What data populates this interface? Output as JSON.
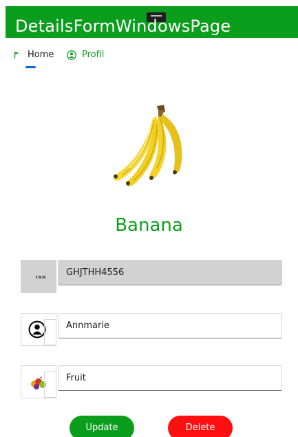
{
  "window": {
    "title": "DetailsFormWindowsPage",
    "accent": "#0b9d1c"
  },
  "nav": {
    "items": [
      {
        "label": "Home",
        "icon": "flag-icon",
        "selected": true
      },
      {
        "label": "Profil",
        "icon": "person-circle-icon",
        "selected": false
      }
    ],
    "selected_indicator_color": "#1565d8"
  },
  "product": {
    "image": "banana-image",
    "name": "Banana"
  },
  "fields": {
    "code": {
      "icon": "barcode-icon",
      "value": "GHJTHH4556",
      "disabled": true
    },
    "name": {
      "icon": "person-icon",
      "value": "Annmarie"
    },
    "category": {
      "icon": "fruit-icon",
      "value": "Fruit"
    }
  },
  "actions": {
    "update_label": "Update",
    "update_color": "#0b9d1c",
    "delete_label": "Delete",
    "delete_color": "#ff0f0f"
  }
}
